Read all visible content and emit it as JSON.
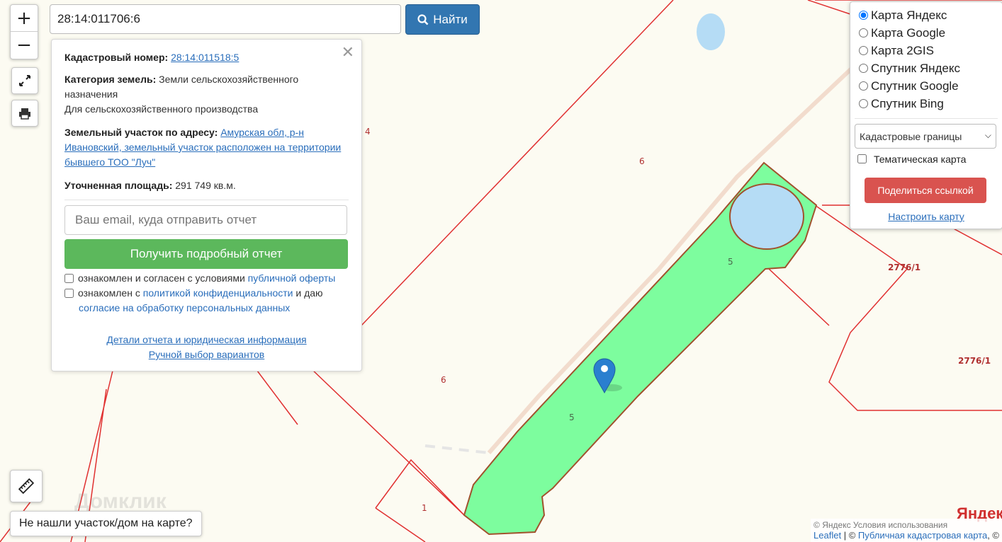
{
  "search": {
    "value": "28:14:011706:6",
    "button_label": "Найти"
  },
  "zoom": {
    "in_label": "+",
    "out_label": "−"
  },
  "controls": {
    "fullscreen_icon": "expand-icon",
    "print_icon": "printer-icon",
    "ruler_icon": "ruler-icon"
  },
  "popup": {
    "close_label": "✕",
    "cadastral_label": "Кадастровый номер:",
    "cadastral_number": "28:14:011518:5",
    "category_label": "Категория земель:",
    "category_value": "Земли сельскохозяйственного назначения",
    "usage": "Для сельскохозяйственного производства",
    "address_label": "Земельный участок по адресу:",
    "address_value": "Амурская обл, р-н Ивановский, земельный участок расположен на территории бывшего ТОО \"Луч\"",
    "area_label": "Уточненная площадь:",
    "area_value": "291 749 кв.м.",
    "email_placeholder": "Ваш email, куда отправить отчет",
    "report_button": "Получить подробный отчет",
    "agree1_text": "ознакомлен и согласен с условиями ",
    "agree1_link": "публичной оферты",
    "agree2_text": "ознакомлен с ",
    "agree2_link": "политикой конфиденциальности",
    "agree2_text2": " и даю",
    "agree2_link2": "согласие на обработку персональных данных",
    "details_link": "Детали отчета и юридическая информация",
    "manual_link": "Ручной выбор вариантов"
  },
  "layers": {
    "options": [
      "Карта Яндекс",
      "Карта Google",
      "Карта 2GIS",
      "Спутник Яндекс",
      "Спутник Google",
      "Спутник Bing"
    ],
    "selected": "Карта Яндекс",
    "overlay_select": "Кадастровые границы",
    "thematic_label": "Тематическая карта",
    "share_button": "Поделиться ссылкой",
    "configure_link": "Настроить карту"
  },
  "map_labels": {
    "label_4": "4",
    "label_6a": "6",
    "label_6b": "6",
    "label_5a": "5",
    "label_5b": "5",
    "label_1": "1",
    "label_2776a": "2776/1",
    "label_2776b": "2776/1"
  },
  "watermark": "Домклик",
  "yandex_logo": "Яндекс",
  "not_found": "Не нашли участок/дом на карте?",
  "attribution": {
    "leaflet": "Leaflet",
    "sep": " | © ",
    "pkk": "Публичная кадастровая карта",
    "tail": ", ©",
    "yandex_terms": "© Яндекс  Условия использования"
  },
  "colors": {
    "parcel_fill": "#7dfd9e",
    "parcel_border": "#a0522d",
    "boundary": "#e03030",
    "water": "#b5dcf5",
    "search_btn": "#3276b1",
    "report_btn": "#5cb85c",
    "share_btn": "#d9534f",
    "marker": "#2a7fcf"
  }
}
